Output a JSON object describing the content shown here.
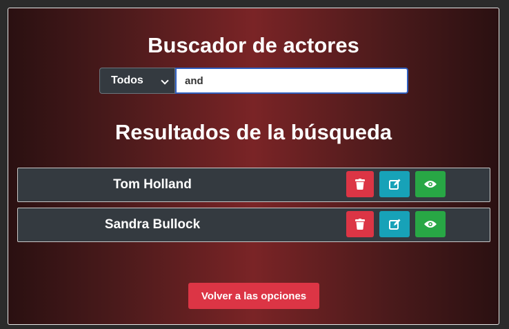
{
  "page": {
    "title": "Buscador de actores",
    "results_title": "Resultados de la búsqueda"
  },
  "search": {
    "filter_selected": "Todos",
    "query": "and"
  },
  "results": [
    {
      "name": "Tom Holland"
    },
    {
      "name": "Sandra Bullock"
    }
  ],
  "actions": {
    "icons": [
      "trash-icon",
      "edit-icon",
      "eye-icon"
    ]
  },
  "footer": {
    "back_label": "Volver a las opciones"
  },
  "colors": {
    "danger": "#dc3545",
    "info": "#17a2b8",
    "success": "#28a745",
    "row_bg": "#343a40"
  }
}
